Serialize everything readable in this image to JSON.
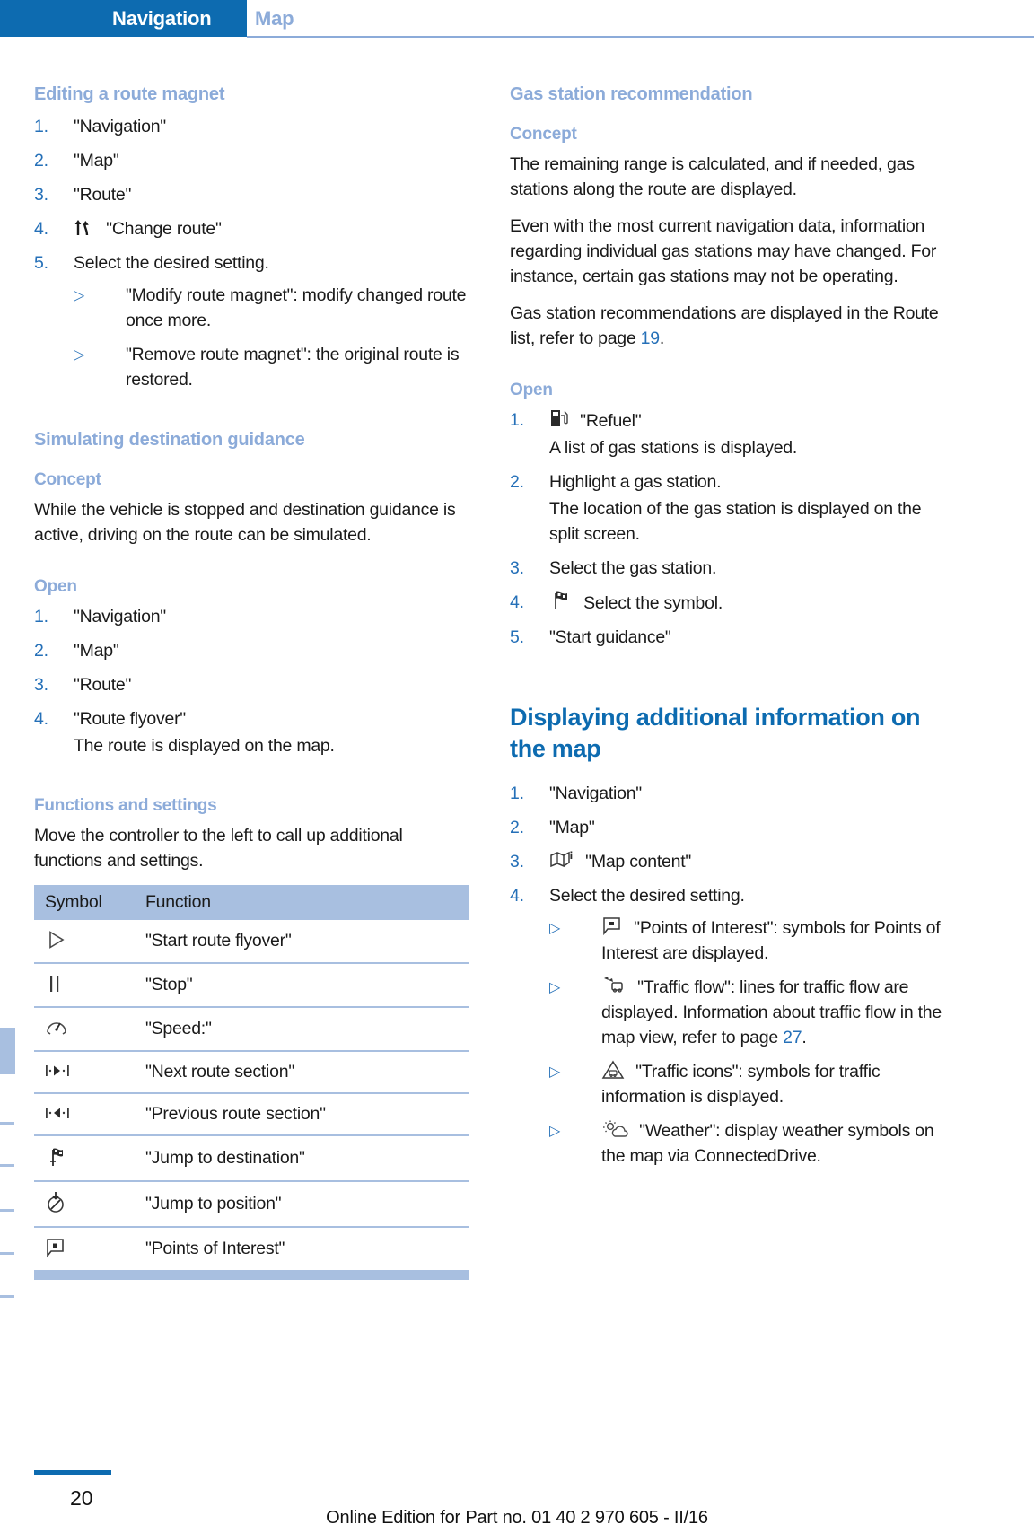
{
  "header": {
    "chapter": "Navigation",
    "section": "Map"
  },
  "left_column": {
    "editing_route_magnet": {
      "heading": "Editing a route magnet",
      "steps": [
        {
          "num": "1.",
          "text": "\"Navigation\""
        },
        {
          "num": "2.",
          "text": "\"Map\""
        },
        {
          "num": "3.",
          "text": "\"Route\""
        },
        {
          "num": "4.",
          "icon": "change-route-icon",
          "text": "\"Change route\""
        },
        {
          "num": "5.",
          "text": "Select the desired setting."
        }
      ],
      "sub_items": [
        "\"Modify route magnet\": modify changed route once more.",
        "\"Remove route magnet\": the original route is restored."
      ]
    },
    "simulating_destination_guidance": {
      "heading": "Simulating destination guidance",
      "concept_head": "Concept",
      "concept_text": "While the vehicle is stopped and destination guidance is active, driving on the route can be simulated.",
      "open_head": "Open",
      "open_steps": [
        {
          "num": "1.",
          "text": "\"Navigation\""
        },
        {
          "num": "2.",
          "text": "\"Map\""
        },
        {
          "num": "3.",
          "text": "\"Route\""
        },
        {
          "num": "4.",
          "text": "\"Route flyover\"",
          "continuation": "The route is displayed on the map."
        }
      ],
      "functions_head": "Functions and settings",
      "functions_intro": "Move the controller to the left to call up additional functions and settings.",
      "table": {
        "columns": [
          "Symbol",
          "Function"
        ],
        "rows": [
          {
            "icon": "play-icon",
            "function": "\"Start route flyover\""
          },
          {
            "icon": "pause-icon",
            "function": "\"Stop\""
          },
          {
            "icon": "speedometer-icon",
            "function": "\"Speed:\""
          },
          {
            "icon": "next-section-icon",
            "function": "\"Next route section\""
          },
          {
            "icon": "previous-section-icon",
            "function": "\"Previous route section\""
          },
          {
            "icon": "checkered-flag-icon",
            "function": "\"Jump to destination\""
          },
          {
            "icon": "position-arrow-icon",
            "function": "\"Jump to position\""
          },
          {
            "icon": "poi-icon",
            "function": "\"Points of Interest\""
          }
        ]
      }
    }
  },
  "right_column": {
    "gas_station_recommendation": {
      "heading": "Gas station recommendation",
      "concept_head": "Concept",
      "concept_paragraphs": [
        "The remaining range is calculated, and if needed, gas stations along the route are displayed.",
        "Even with the most current navigation data, information regarding individual gas stations may have changed. For instance, certain gas stations may not be operating."
      ],
      "route_list_text_before": "Gas station recommendations are displayed in the Route list, refer to page ",
      "route_list_page_ref": "19",
      "route_list_text_after": ".",
      "open_head": "Open",
      "open_steps": [
        {
          "num": "1.",
          "icon": "fuel-pump-icon",
          "text": "\"Refuel\"",
          "continuation": "A list of gas stations is displayed."
        },
        {
          "num": "2.",
          "text": "Highlight a gas station.",
          "continuation": "The location of the gas station is displayed on the split screen."
        },
        {
          "num": "3.",
          "text": "Select the gas station."
        },
        {
          "num": "4.",
          "icon": "checkered-flag-icon",
          "text": "Select the symbol."
        },
        {
          "num": "5.",
          "text": "\"Start guidance\""
        }
      ]
    },
    "displaying_additional_information": {
      "heading": "Displaying additional information on the map",
      "steps": [
        {
          "num": "1.",
          "text": "\"Navigation\""
        },
        {
          "num": "2.",
          "text": "\"Map\""
        },
        {
          "num": "3.",
          "icon": "map-content-icon",
          "text": "\"Map content\""
        },
        {
          "num": "4.",
          "text": "Select the desired setting."
        }
      ],
      "sub_items": [
        {
          "icon": "poi-icon",
          "text": "\"Points of Interest\": symbols for Points of Interest are displayed."
        },
        {
          "icon": "traffic-flow-icon",
          "text_before": "\"Traffic flow\": lines for traffic flow are displayed. Information about traffic flow in the map view, refer to page ",
          "page_ref": "27",
          "text_after": "."
        },
        {
          "icon": "traffic-icons-icon",
          "text": "\"Traffic icons\": symbols for traffic information is displayed."
        },
        {
          "icon": "weather-icon",
          "text": "\"Weather\": display weather symbols on the map via ConnectedDrive."
        }
      ]
    }
  },
  "footer": {
    "page_number": "20",
    "edition": "Online Edition for Part no. 01 40 2 970 605 - II/16"
  },
  "colors": {
    "header_blue": "#0d6bb0",
    "light_blue": "#8cabd9",
    "table_blue": "#a8bfe0",
    "link_blue": "#2570b8"
  }
}
